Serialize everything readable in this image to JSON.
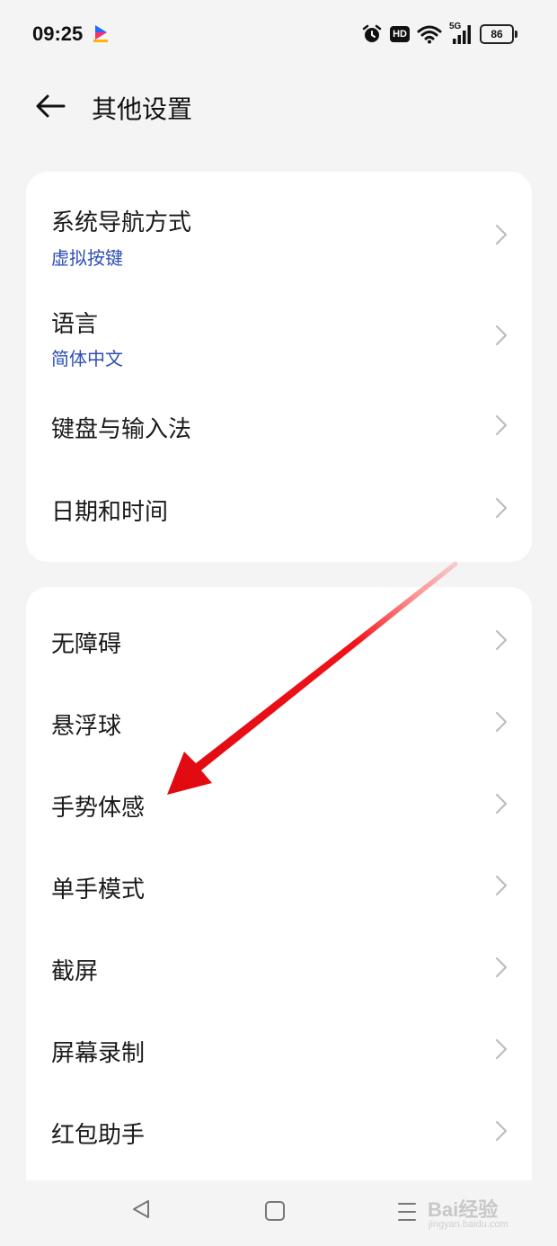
{
  "status_bar": {
    "time": "09:25",
    "network": "5G",
    "hd_label": "HD",
    "battery": "86",
    "icons": [
      "app-logo-icon",
      "alarm-icon",
      "hd-icon",
      "wifi-icon",
      "signal-5g-icon",
      "battery-icon"
    ]
  },
  "header": {
    "title": "其他设置",
    "back_icon": "arrow-left-icon"
  },
  "group1": {
    "items": [
      {
        "label": "系统导航方式",
        "value": "虚拟按键"
      },
      {
        "label": "语言",
        "value": "简体中文"
      },
      {
        "label": "键盘与输入法"
      },
      {
        "label": "日期和时间"
      }
    ]
  },
  "group2": {
    "items": [
      {
        "label": "无障碍"
      },
      {
        "label": "悬浮球"
      },
      {
        "label": "手势体感"
      },
      {
        "label": "单手模式"
      },
      {
        "label": "截屏"
      },
      {
        "label": "屏幕录制"
      },
      {
        "label": "红包助手"
      }
    ]
  },
  "navbar": {
    "icons": [
      "nav-back-icon",
      "nav-home-icon",
      "nav-recents-icon"
    ]
  },
  "annotation": {
    "arrow_color": "#e8131a",
    "target": "手势体感"
  },
  "watermark": {
    "brand": "Bai经验",
    "url": "jingyan.baidu.com"
  },
  "colors": {
    "background": "#f4f4f4",
    "card": "#ffffff",
    "accent": "#2e4fb4",
    "text": "#1a1a1a"
  }
}
